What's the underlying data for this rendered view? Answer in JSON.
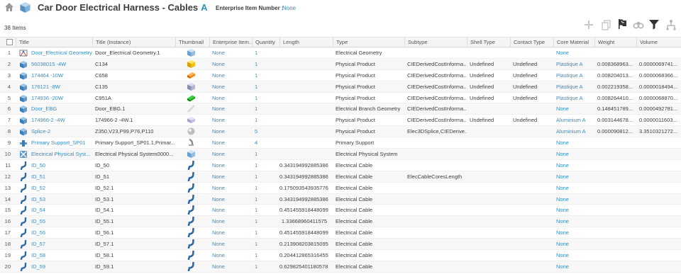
{
  "header": {
    "title": "Car Door Electrical Harness - Cables",
    "revision": "A",
    "enterprise_label": "Enterprise Item Number :",
    "enterprise_value": "None",
    "home_icon": "home-icon",
    "object_icon": "cube-icon"
  },
  "item_count": "38 Items",
  "toolbar": [
    {
      "name": "add-icon"
    },
    {
      "name": "copy-icon"
    },
    {
      "name": "flag-icon"
    },
    {
      "name": "find-icon"
    },
    {
      "name": "filter-icon"
    },
    {
      "name": "hierarchy-icon"
    }
  ],
  "columns": [
    "Title",
    "Title (Instance)",
    "Thumbnail",
    "Enterprise Item...",
    "Quantity",
    "Length",
    "Type",
    "Subtype",
    "Shell Type",
    "Contact Type",
    "Core Material",
    "Weight",
    "Volume"
  ],
  "rows": [
    {
      "n": "1",
      "title": "Door_Electrical Geometry",
      "inst": "Door_Electrical Geometry.1",
      "thumb": "cube-blue",
      "ent": "None",
      "qty": "1",
      "len": "",
      "type": "Electrical Geometry",
      "sub": "",
      "shell": "",
      "contact": "",
      "core": "None",
      "weight": "",
      "volume": "",
      "icon": "geometry-icon"
    },
    {
      "n": "2",
      "title": "56038015 -4W",
      "inst": "C134",
      "thumb": "connector-yellow",
      "ent": "None",
      "qty": "1",
      "len": "",
      "type": "Physical Product",
      "sub": "CIEDerivedCostInforma...",
      "shell": "Undefined",
      "contact": "Undefined",
      "core": "Plastique A",
      "weight": "0.008368963...",
      "volume": "0.0000069741...",
      "icon": "product-icon"
    },
    {
      "n": "3",
      "title": "174464 -10W",
      "inst": "C658",
      "thumb": "connector-orange",
      "ent": "None",
      "qty": "1",
      "len": "",
      "type": "Physical Product",
      "sub": "CIEDerivedCostInforma...",
      "shell": "Undefined",
      "contact": "Undefined",
      "core": "Plastique A",
      "weight": "0.008204013...",
      "volume": "0.0000068366...",
      "icon": "product-icon"
    },
    {
      "n": "4",
      "title": "176121 -8W",
      "inst": "C135",
      "thumb": "connector-grey",
      "ent": "None",
      "qty": "1",
      "len": "",
      "type": "Physical Product",
      "sub": "CIEDerivedCostInforma...",
      "shell": "Undefined",
      "contact": "Undefined",
      "core": "Plastique A",
      "weight": "0.002219358...",
      "volume": "0.0000018494...",
      "icon": "product-icon"
    },
    {
      "n": "5",
      "title": "174936 -20W",
      "inst": "C951A",
      "thumb": "connector-green",
      "ent": "None",
      "qty": "1",
      "len": "",
      "type": "Physical Product",
      "sub": "CIEDerivedCostInforma...",
      "shell": "Undefined",
      "contact": "Undefined",
      "core": "Plastique A",
      "weight": "0.008264410...",
      "volume": "0.0000068870...",
      "icon": "product-icon"
    },
    {
      "n": "6",
      "title": "Door_EBG",
      "inst": "Door_EBG.1",
      "thumb": "branch-white",
      "ent": "None",
      "qty": "1",
      "len": "",
      "type": "Electrical Branch Geometry",
      "sub": "CIEDerivedCostInforma...",
      "shell": "",
      "contact": "",
      "core": "None",
      "weight": "0.148451789...",
      "volume": "0.0000492781...",
      "icon": "product-icon"
    },
    {
      "n": "7",
      "title": "174966-2 -4W",
      "inst": "174966-2 -4W.1",
      "thumb": "connector-lilac",
      "ent": "None",
      "qty": "1",
      "len": "",
      "type": "Physical Product",
      "sub": "CIEDerivedCostInforma...",
      "shell": "Undefined",
      "contact": "Undefined",
      "core": "Aluminium A",
      "weight": "0.003144678...",
      "volume": "0.0000011603...",
      "icon": "product-icon"
    },
    {
      "n": "8",
      "title": "Splice-2",
      "inst": "Z350,V23,P99,P76,P110",
      "thumb": "sphere-grey",
      "ent": "None",
      "qty": "5",
      "len": "",
      "type": "Physical Product",
      "sub": "Elec3DSplice,CIEDerive...",
      "shell": "",
      "contact": "",
      "core": "Aluminium A",
      "weight": "0.000090812...",
      "volume": "3.3510321272...",
      "icon": "product-icon"
    },
    {
      "n": "9",
      "title": "Primary Support_SP01",
      "inst": "Primary Support_SP01.1,Primar...",
      "thumb": "support-grey",
      "ent": "None",
      "qty": "4",
      "len": "",
      "type": "Primary Support",
      "sub": "",
      "shell": "",
      "contact": "",
      "core": "None",
      "weight": "",
      "volume": "",
      "icon": "support-icon"
    },
    {
      "n": "10",
      "title": "Electrical Physical Syst...",
      "inst": "Electrical Physical System0000...",
      "thumb": "cube-blue",
      "ent": "None",
      "qty": "1",
      "len": "",
      "type": "Electrical Physical System",
      "sub": "",
      "shell": "",
      "contact": "",
      "core": "None",
      "weight": "",
      "volume": "",
      "icon": "system-icon"
    },
    {
      "n": "11",
      "title": "ID_50",
      "inst": "ID_50",
      "thumb": "cable-blue",
      "ent": "None",
      "qty": "1",
      "len": "0.343194992885386",
      "type": "Electrical Cable",
      "sub": "",
      "shell": "",
      "contact": "",
      "core": "None",
      "weight": "",
      "volume": "",
      "icon": "cable-icon"
    },
    {
      "n": "12",
      "title": "ID_51",
      "inst": "ID_51",
      "thumb": "cable-blue",
      "ent": "None",
      "qty": "1",
      "len": "0.343194992885386",
      "type": "Electrical Cable",
      "sub": "ElecCableCoresLength",
      "shell": "",
      "contact": "",
      "core": "None",
      "weight": "",
      "volume": "",
      "icon": "cable-icon"
    },
    {
      "n": "13",
      "title": "ID_52",
      "inst": "ID_52.1",
      "thumb": "cable-blue",
      "ent": "None",
      "qty": "1",
      "len": "0.175093543935776",
      "type": "Electrical Cable",
      "sub": "",
      "shell": "",
      "contact": "",
      "core": "None",
      "weight": "",
      "volume": "",
      "icon": "cable-icon"
    },
    {
      "n": "14",
      "title": "ID_53",
      "inst": "ID_53.1",
      "thumb": "cable-blue",
      "ent": "None",
      "qty": "1",
      "len": "0.343194992885386",
      "type": "Electrical Cable",
      "sub": "",
      "shell": "",
      "contact": "",
      "core": "None",
      "weight": "",
      "volume": "",
      "icon": "cable-icon"
    },
    {
      "n": "15",
      "title": "ID_54",
      "inst": "ID_54.1",
      "thumb": "cable-blue",
      "ent": "None",
      "qty": "1",
      "len": "0.451455918448099",
      "type": "Electrical Cable",
      "sub": "",
      "shell": "",
      "contact": "",
      "core": "None",
      "weight": "",
      "volume": "",
      "icon": "cable-icon"
    },
    {
      "n": "16",
      "title": "ID_55",
      "inst": "ID_55.1",
      "thumb": "cable-blue",
      "ent": "None",
      "qty": "1",
      "len": "1.33668960411575",
      "type": "Electrical Cable",
      "sub": "",
      "shell": "",
      "contact": "",
      "core": "None",
      "weight": "",
      "volume": "",
      "icon": "cable-icon"
    },
    {
      "n": "17",
      "title": "ID_56",
      "inst": "ID_56.1",
      "thumb": "cable-blue",
      "ent": "None",
      "qty": "1",
      "len": "0.451455918448099",
      "type": "Electrical Cable",
      "sub": "",
      "shell": "",
      "contact": "",
      "core": "None",
      "weight": "",
      "volume": "",
      "icon": "cable-icon"
    },
    {
      "n": "18",
      "title": "ID_57",
      "inst": "ID_57.1",
      "thumb": "cable-blue",
      "ent": "None",
      "qty": "1",
      "len": "0.213908203815095",
      "type": "Electrical Cable",
      "sub": "",
      "shell": "",
      "contact": "",
      "core": "None",
      "weight": "",
      "volume": "",
      "icon": "cable-icon"
    },
    {
      "n": "19",
      "title": "ID_58",
      "inst": "ID_58.1",
      "thumb": "cable-blue",
      "ent": "None",
      "qty": "1",
      "len": "0.204412865316455",
      "type": "Electrical Cable",
      "sub": "",
      "shell": "",
      "contact": "",
      "core": "None",
      "weight": "",
      "volume": "",
      "icon": "cable-icon"
    },
    {
      "n": "20",
      "title": "ID_59",
      "inst": "ID_59.1",
      "thumb": "cable-blue",
      "ent": "None",
      "qty": "1",
      "len": "0.629825401180578",
      "type": "Electrical Cable",
      "sub": "",
      "shell": "",
      "contact": "",
      "core": "None",
      "weight": "",
      "volume": "",
      "icon": "cable-icon"
    }
  ]
}
